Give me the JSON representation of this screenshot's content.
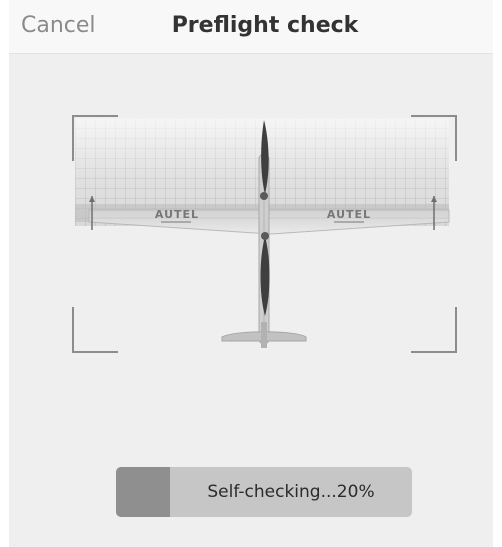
{
  "header": {
    "cancel_label": "Cancel",
    "title": "Preflight check"
  },
  "aircraft": {
    "left_wing_logo": "AUTEL",
    "right_wing_logo": "AUTEL"
  },
  "progress": {
    "label": "Self-checking...20%",
    "percent": 20
  },
  "colors": {
    "background": "#efefef",
    "header": "#f8f8f8",
    "progress_track": "#c6c6c6",
    "progress_fill": "#8f8f8f"
  }
}
